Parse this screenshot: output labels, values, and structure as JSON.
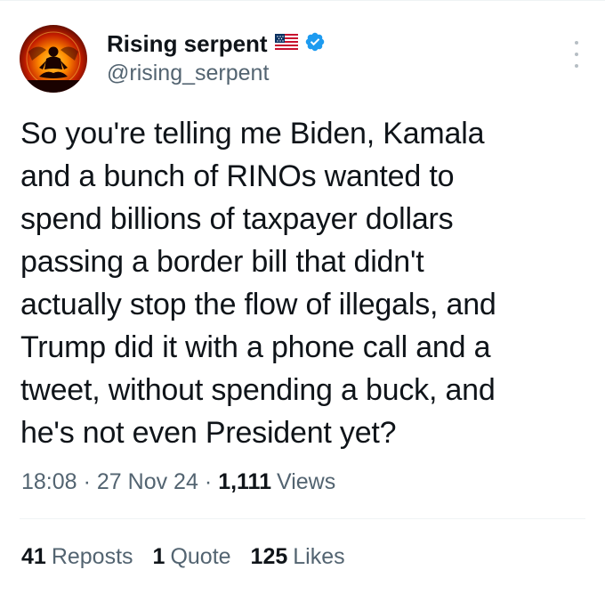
{
  "author": {
    "display_name": "Rising serpent",
    "handle": "@rising_serpent",
    "flag_icon": "us-flag-icon",
    "verified_icon": "verified-badge-icon",
    "verified_color": "#1d9bf0"
  },
  "more_icon": "more-vertical-icon",
  "tweet": {
    "text": "So you're telling me Biden, Kamala\nand a bunch of RINOs wanted to\nspend billions of taxpayer dollars\npassing a border bill that didn't\nactually stop the flow of illegals, and\nTrump did it with a phone call and a\ntweet, without spending a buck, and\nhe's not even President yet?"
  },
  "meta": {
    "time": "18:08",
    "separator": "·",
    "date": "27 Nov 24",
    "views_count": "1,111",
    "views_label": "Views"
  },
  "stats": {
    "reposts_count": "41",
    "reposts_label": "Reposts",
    "quotes_count": "1",
    "quotes_label": "Quote",
    "likes_count": "125",
    "likes_label": "Likes"
  },
  "colors": {
    "text_primary": "#0f1419",
    "text_secondary": "#536471",
    "divider": "#eff3f4"
  }
}
